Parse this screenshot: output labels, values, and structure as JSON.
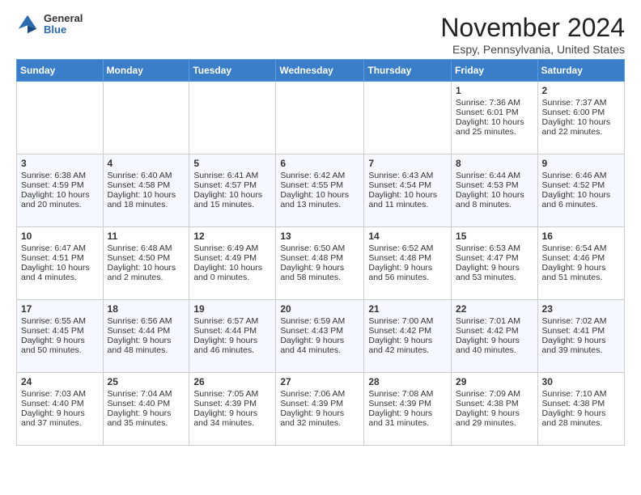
{
  "header": {
    "logo_general": "General",
    "logo_blue": "Blue",
    "month_title": "November 2024",
    "location": "Espy, Pennsylvania, United States"
  },
  "days_of_week": [
    "Sunday",
    "Monday",
    "Tuesday",
    "Wednesday",
    "Thursday",
    "Friday",
    "Saturday"
  ],
  "weeks": [
    [
      {
        "day": "",
        "info": ""
      },
      {
        "day": "",
        "info": ""
      },
      {
        "day": "",
        "info": ""
      },
      {
        "day": "",
        "info": ""
      },
      {
        "day": "",
        "info": ""
      },
      {
        "day": "1",
        "info": "Sunrise: 7:36 AM\nSunset: 6:01 PM\nDaylight: 10 hours and 25 minutes."
      },
      {
        "day": "2",
        "info": "Sunrise: 7:37 AM\nSunset: 6:00 PM\nDaylight: 10 hours and 22 minutes."
      }
    ],
    [
      {
        "day": "3",
        "info": "Sunrise: 6:38 AM\nSunset: 4:59 PM\nDaylight: 10 hours and 20 minutes."
      },
      {
        "day": "4",
        "info": "Sunrise: 6:40 AM\nSunset: 4:58 PM\nDaylight: 10 hours and 18 minutes."
      },
      {
        "day": "5",
        "info": "Sunrise: 6:41 AM\nSunset: 4:57 PM\nDaylight: 10 hours and 15 minutes."
      },
      {
        "day": "6",
        "info": "Sunrise: 6:42 AM\nSunset: 4:55 PM\nDaylight: 10 hours and 13 minutes."
      },
      {
        "day": "7",
        "info": "Sunrise: 6:43 AM\nSunset: 4:54 PM\nDaylight: 10 hours and 11 minutes."
      },
      {
        "day": "8",
        "info": "Sunrise: 6:44 AM\nSunset: 4:53 PM\nDaylight: 10 hours and 8 minutes."
      },
      {
        "day": "9",
        "info": "Sunrise: 6:46 AM\nSunset: 4:52 PM\nDaylight: 10 hours and 6 minutes."
      }
    ],
    [
      {
        "day": "10",
        "info": "Sunrise: 6:47 AM\nSunset: 4:51 PM\nDaylight: 10 hours and 4 minutes."
      },
      {
        "day": "11",
        "info": "Sunrise: 6:48 AM\nSunset: 4:50 PM\nDaylight: 10 hours and 2 minutes."
      },
      {
        "day": "12",
        "info": "Sunrise: 6:49 AM\nSunset: 4:49 PM\nDaylight: 10 hours and 0 minutes."
      },
      {
        "day": "13",
        "info": "Sunrise: 6:50 AM\nSunset: 4:48 PM\nDaylight: 9 hours and 58 minutes."
      },
      {
        "day": "14",
        "info": "Sunrise: 6:52 AM\nSunset: 4:48 PM\nDaylight: 9 hours and 56 minutes."
      },
      {
        "day": "15",
        "info": "Sunrise: 6:53 AM\nSunset: 4:47 PM\nDaylight: 9 hours and 53 minutes."
      },
      {
        "day": "16",
        "info": "Sunrise: 6:54 AM\nSunset: 4:46 PM\nDaylight: 9 hours and 51 minutes."
      }
    ],
    [
      {
        "day": "17",
        "info": "Sunrise: 6:55 AM\nSunset: 4:45 PM\nDaylight: 9 hours and 50 minutes."
      },
      {
        "day": "18",
        "info": "Sunrise: 6:56 AM\nSunset: 4:44 PM\nDaylight: 9 hours and 48 minutes."
      },
      {
        "day": "19",
        "info": "Sunrise: 6:57 AM\nSunset: 4:44 PM\nDaylight: 9 hours and 46 minutes."
      },
      {
        "day": "20",
        "info": "Sunrise: 6:59 AM\nSunset: 4:43 PM\nDaylight: 9 hours and 44 minutes."
      },
      {
        "day": "21",
        "info": "Sunrise: 7:00 AM\nSunset: 4:42 PM\nDaylight: 9 hours and 42 minutes."
      },
      {
        "day": "22",
        "info": "Sunrise: 7:01 AM\nSunset: 4:42 PM\nDaylight: 9 hours and 40 minutes."
      },
      {
        "day": "23",
        "info": "Sunrise: 7:02 AM\nSunset: 4:41 PM\nDaylight: 9 hours and 39 minutes."
      }
    ],
    [
      {
        "day": "24",
        "info": "Sunrise: 7:03 AM\nSunset: 4:40 PM\nDaylight: 9 hours and 37 minutes."
      },
      {
        "day": "25",
        "info": "Sunrise: 7:04 AM\nSunset: 4:40 PM\nDaylight: 9 hours and 35 minutes."
      },
      {
        "day": "26",
        "info": "Sunrise: 7:05 AM\nSunset: 4:39 PM\nDaylight: 9 hours and 34 minutes."
      },
      {
        "day": "27",
        "info": "Sunrise: 7:06 AM\nSunset: 4:39 PM\nDaylight: 9 hours and 32 minutes."
      },
      {
        "day": "28",
        "info": "Sunrise: 7:08 AM\nSunset: 4:39 PM\nDaylight: 9 hours and 31 minutes."
      },
      {
        "day": "29",
        "info": "Sunrise: 7:09 AM\nSunset: 4:38 PM\nDaylight: 9 hours and 29 minutes."
      },
      {
        "day": "30",
        "info": "Sunrise: 7:10 AM\nSunset: 4:38 PM\nDaylight: 9 hours and 28 minutes."
      }
    ]
  ]
}
